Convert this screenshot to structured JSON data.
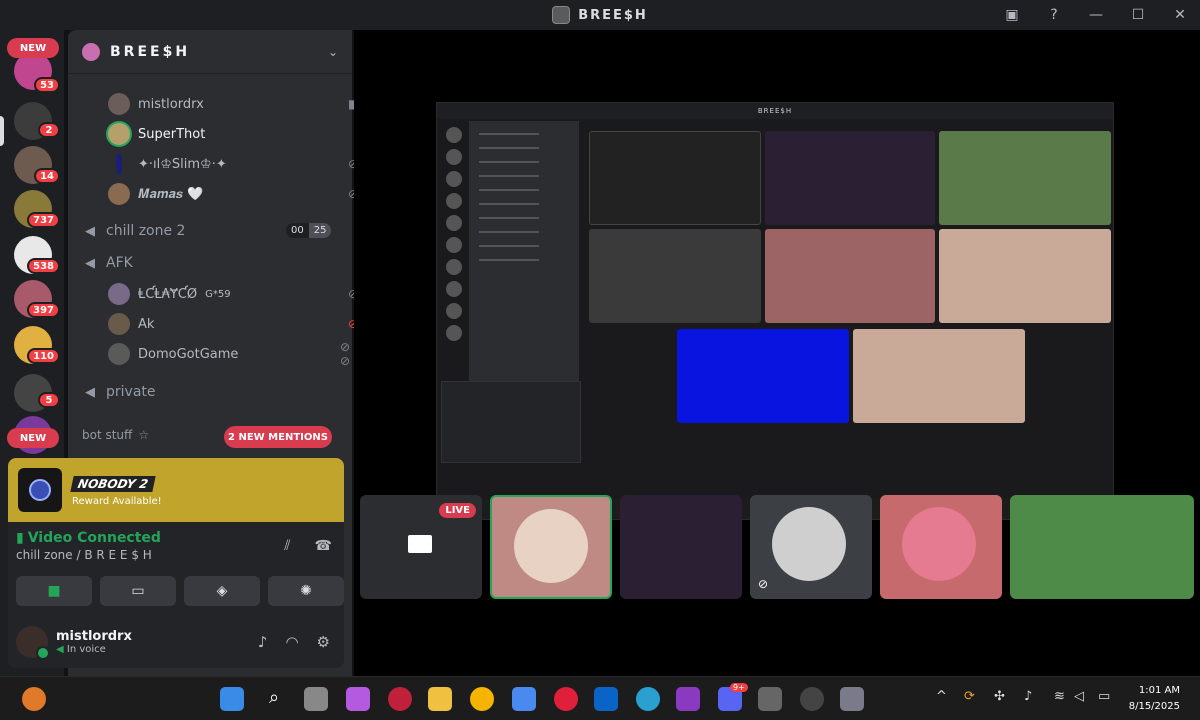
{
  "window": {
    "title": "BREE$H"
  },
  "rail": {
    "new_top": "NEW",
    "new_bottom": "NEW",
    "badges": [
      "53",
      "2",
      "14",
      "737",
      "538",
      "397",
      "110",
      "5"
    ]
  },
  "server": {
    "name": "BREE$H",
    "members_top": [
      {
        "name": "mistlordrx",
        "color": "#6b5e5a"
      },
      {
        "name": "SuperThot",
        "color": "#b59f6a"
      },
      {
        "name": "✦·ıl♔Slim♔·✦",
        "color": "#1a1d7a"
      },
      {
        "name": "𝑴𝒂𝒎𝒂𝒔 🤍",
        "color": "#8a6b52"
      }
    ],
    "channels": {
      "chill_zone_2": "chill zone 2",
      "limit_current": "00",
      "limit_max": "25",
      "afk": "AFK",
      "private": "private"
    },
    "afk_members": [
      {
        "name": "ⱠƇⱠ₳ɎƇØ",
        "tag": "G*59",
        "color": "#7a6a8a"
      },
      {
        "name": "Ak",
        "color": "#6a5a4a"
      },
      {
        "name": "DomoGotGame",
        "color": "#5a5a5a"
      }
    ],
    "category": "bot stuff",
    "mentions": "2 NEW MENTIONS"
  },
  "quest": {
    "game": "NOBODY 2",
    "reward": "Reward Available!"
  },
  "voice": {
    "status": "Video Connected",
    "channel": "chill zone / B R E E $ H"
  },
  "user": {
    "name": "mistlordrx",
    "status": "In voice"
  },
  "stage": {
    "shared_title": "BREE$H",
    "live": "LIVE"
  },
  "taskbar": {
    "time": "1:01 AM",
    "date": "8/15/2025",
    "discord_badge": "9+"
  }
}
